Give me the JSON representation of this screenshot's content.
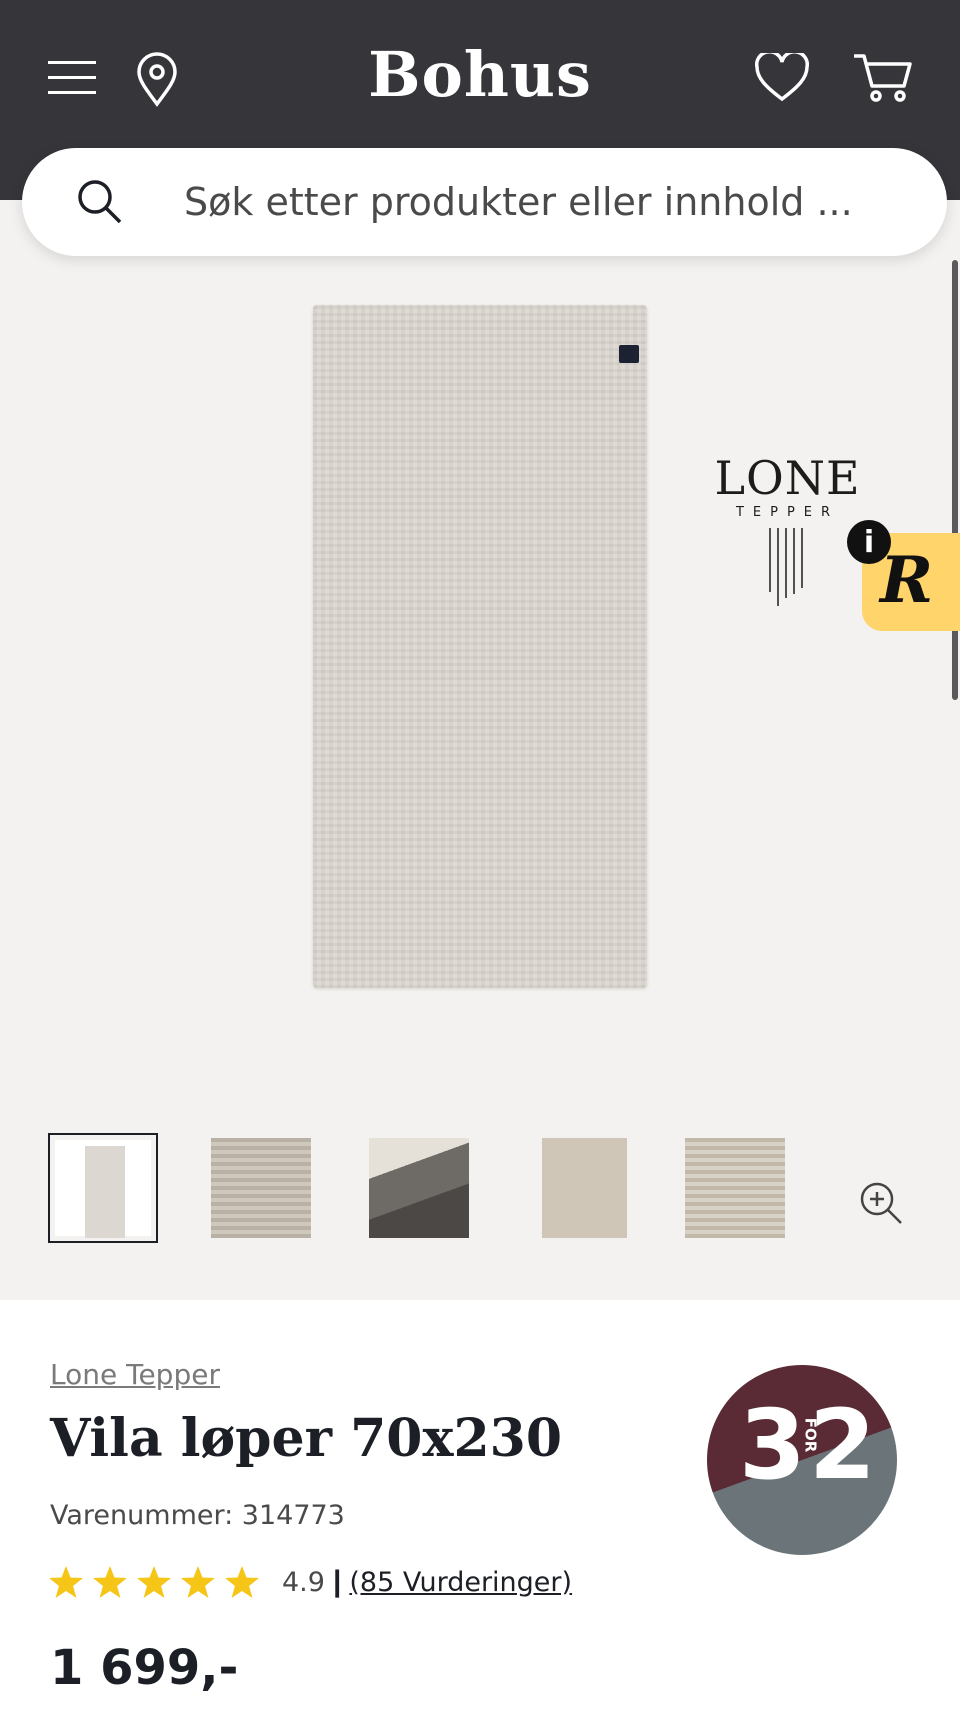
{
  "header": {
    "logo": "Bohus",
    "icons": [
      "menu-icon",
      "location-pin-icon",
      "heart-icon",
      "cart-icon"
    ]
  },
  "search": {
    "placeholder": "Søk etter produkter eller innhold ..."
  },
  "gallery": {
    "brand_logo": {
      "name": "LONE",
      "sub": "TEPPER"
    },
    "widget_letter": "R",
    "info_badge": "i",
    "thumbnail_count": 5,
    "selected_thumbnail": 1
  },
  "product": {
    "brand": "Lone Tepper",
    "title": "Vila løper 70x230",
    "sku": "Varenummer: 314773",
    "rating": {
      "stars": 5,
      "value": "4.9",
      "separator": "|",
      "reviews": "(85 Vurderinger)"
    },
    "price": "1 699,-",
    "promo": {
      "left": "3",
      "mid": "FOR",
      "right": "2"
    }
  },
  "colors": {
    "header_bg": "#35353a",
    "gallery_bg": "#f4f2f0",
    "star": "#f5c518",
    "promo_top": "#5a2a35",
    "promo_bottom": "#6b7478",
    "widget_bg": "#ffd46b"
  }
}
